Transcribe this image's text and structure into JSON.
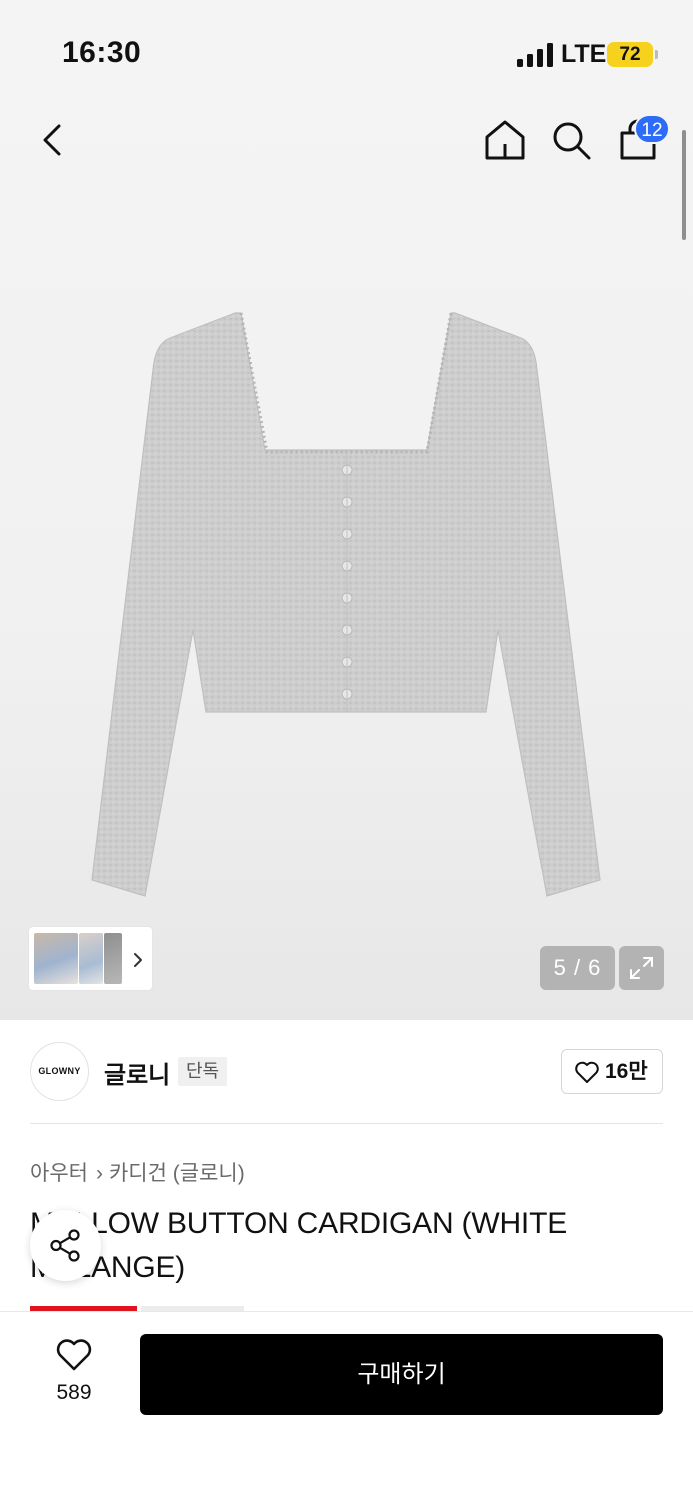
{
  "status_bar": {
    "time": "16:30",
    "network": "LTE",
    "battery": "72",
    "battery_color": "#f7d21c"
  },
  "nav": {
    "back_icon": "chevron-left-icon",
    "home_icon": "home-icon",
    "search_icon": "search-icon",
    "cart_icon": "shopping-bag-icon",
    "cart_count": "12",
    "badge_color": "#2d6cf6"
  },
  "gallery": {
    "counter": "5 / 6",
    "current_index": 5,
    "total": 6,
    "expand_icon": "expand-icon",
    "thumbnail_more_icon": "chevron-right-icon"
  },
  "brand": {
    "logo_text": "GLOWNY",
    "name": "글로니",
    "tag": "단독",
    "like_count": "16만"
  },
  "breadcrumb": {
    "items": [
      "아우터",
      "카디건 (글로니)"
    ]
  },
  "product": {
    "title": "MELLOW BUTTON CARDIGAN (WHITE MELANGE)"
  },
  "bottom_bar": {
    "wish_count": "589",
    "buy_label": "구매하기"
  },
  "colors": {
    "accent_red": "#e0141e",
    "buy_button": "#000000"
  }
}
